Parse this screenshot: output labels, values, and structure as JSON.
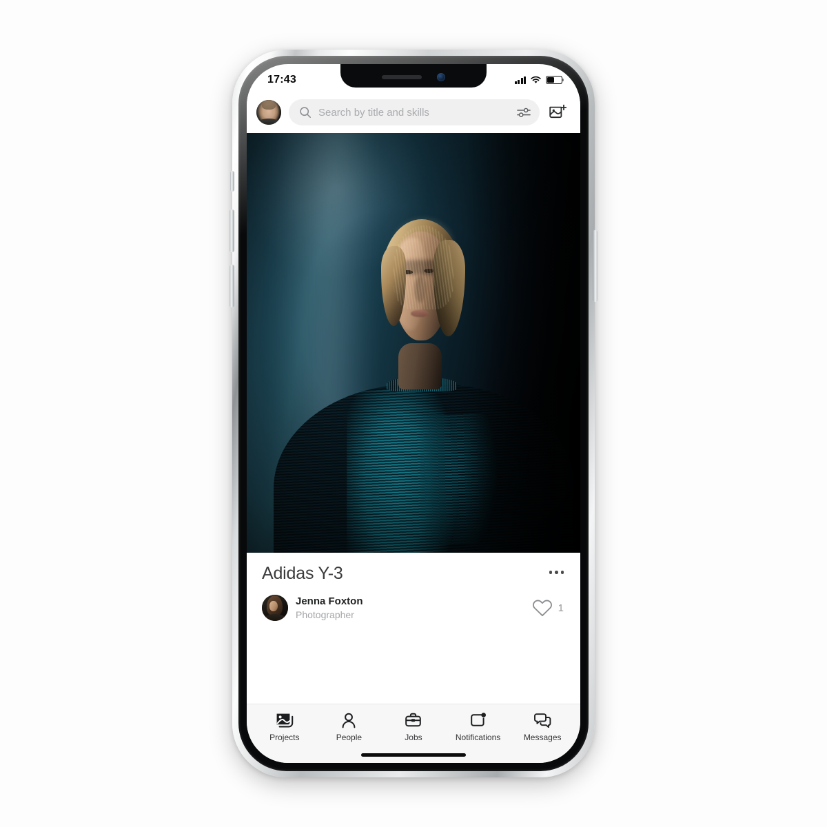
{
  "background_color": "#fdfdfd",
  "device": {
    "name": "smartphone-mockup",
    "buttons": {
      "mute_switch": "mute-switch",
      "volume_up": "volume-up",
      "volume_down": "volume-down",
      "power": "power-button"
    },
    "notch": {
      "speaker": "speaker-grille",
      "camera": "front-camera"
    },
    "home_indicator": "home-indicator"
  },
  "status_bar": {
    "time": "17:43",
    "signal_icon": "cellular-signal-icon",
    "signal_bars": 4,
    "wifi_icon": "wifi-icon",
    "battery_icon": "battery-icon",
    "battery_level_percent": 52
  },
  "app_bar": {
    "avatar": "user-avatar",
    "search": {
      "placeholder": "Search by title and skills",
      "value": "",
      "search_icon": "search-icon",
      "filter_icon": "filter-sliders-icon"
    },
    "add_button_icon": "add-photo-icon"
  },
  "post": {
    "image_alt": "portrait-photo",
    "title": "Adidas Y-3",
    "more_options_icon": "more-options-icon",
    "author": {
      "name": "Jenna Foxton",
      "role": "Photographer",
      "avatar": "author-avatar"
    },
    "likes": {
      "icon": "heart-outline-icon",
      "count": "1"
    }
  },
  "tab_bar": {
    "active": "Projects",
    "items": [
      {
        "label": "Projects",
        "icon": "projects-image-icon",
        "active": true,
        "badge": false
      },
      {
        "label": "People",
        "icon": "person-icon",
        "active": false,
        "badge": false
      },
      {
        "label": "Jobs",
        "icon": "briefcase-icon",
        "active": false,
        "badge": false
      },
      {
        "label": "Notifications",
        "icon": "notifications-icon",
        "active": false,
        "badge": true
      },
      {
        "label": "Messages",
        "icon": "messages-icon",
        "active": false,
        "badge": false
      }
    ]
  },
  "colors": {
    "accent": "#1f2021",
    "muted_text": "#a4a6a9",
    "search_pill": "#f0f0f1",
    "tab_bar_bg": "#f7f7f7",
    "photo_teal": "#21505f"
  }
}
